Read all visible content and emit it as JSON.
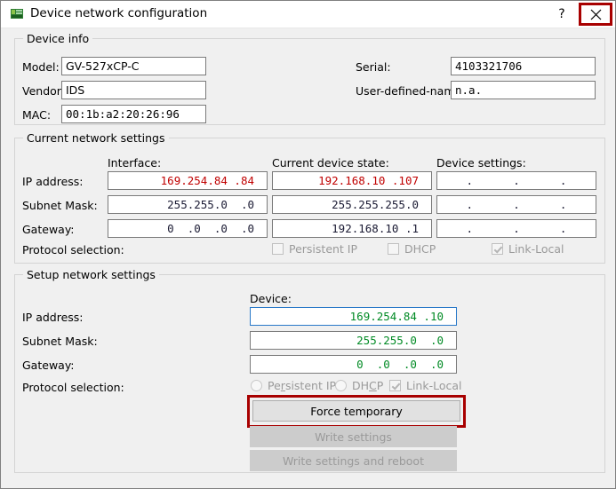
{
  "window": {
    "title": "Device network configuration",
    "icon": "network-card-icon",
    "help_label": "?",
    "close_label": "×",
    "highlight_color": "#a80000"
  },
  "device_info": {
    "group_title": "Device info",
    "fields": [
      {
        "label": "Model:",
        "value": "GV-527xCP-C"
      },
      {
        "label": "Vendor:",
        "value": "IDS"
      },
      {
        "label": "MAC:",
        "value": "00:1b:a2:20:26:96"
      },
      {
        "label": "Serial:",
        "value": "4103321706"
      },
      {
        "label": "User-defined-name:",
        "value": "n.a."
      }
    ]
  },
  "current_network_settings": {
    "group_title": "Current network settings",
    "columns": [
      "Interface:",
      "Current device state:",
      "Device settings:"
    ],
    "rows": [
      {
        "label": "IP address:",
        "interface": "169.254.84 .84",
        "device_state": "192.168.10 .107",
        "device_settings": ".      .      ."
      },
      {
        "label": "Subnet Mask:",
        "interface": "255.255.0  .0",
        "device_state": "255.255.255.0",
        "device_settings": ".      .      ."
      },
      {
        "label": "Gateway:",
        "interface": "0  .0  .0  .0",
        "device_state": "192.168.10 .1",
        "device_settings": ".      .      ."
      }
    ],
    "protocol_label": "Protocol selection:",
    "protocols": [
      {
        "label": "Persistent IP",
        "checked": false
      },
      {
        "label": "DHCP",
        "checked": false
      },
      {
        "label": "Link-Local",
        "checked": true
      }
    ]
  },
  "setup_network_settings": {
    "group_title": "Setup network settings",
    "column": "Device:",
    "rows": [
      {
        "label": "IP address:",
        "value": "169.254.84 .10"
      },
      {
        "label": "Subnet Mask:",
        "value": "255.255.0  .0"
      },
      {
        "label": "Gateway:",
        "value": "0  .0  .0  .0"
      }
    ],
    "protocol_label": "Protocol selection:",
    "protocols": [
      {
        "label_pre": "Pe",
        "label_accel": "r",
        "label_post": "sistent IP",
        "type": "radio",
        "checked": false
      },
      {
        "label_pre": "DH",
        "label_accel": "C",
        "label_post": "P",
        "type": "radio",
        "checked": false
      },
      {
        "label_pre": "Link-Local",
        "label_accel": "",
        "label_post": "",
        "type": "checkbox",
        "checked": true
      }
    ],
    "buttons": [
      {
        "label": "Force temporary",
        "enabled": true,
        "highlighted": true
      },
      {
        "label": "Write settings",
        "enabled": false,
        "highlighted": false
      },
      {
        "label": "Write settings and reboot",
        "enabled": false,
        "highlighted": false
      }
    ]
  }
}
